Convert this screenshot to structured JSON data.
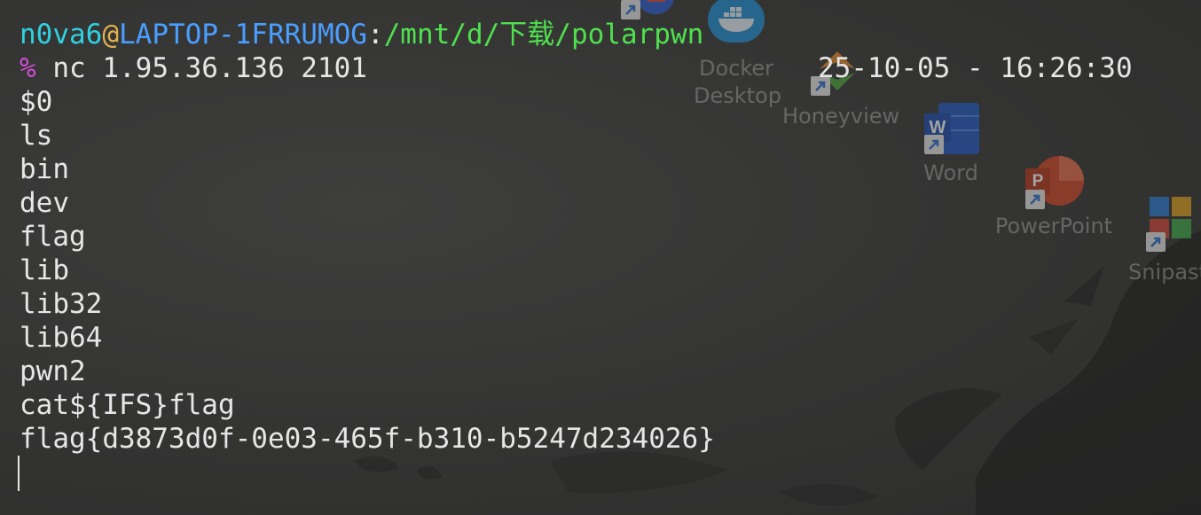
{
  "desktop": {
    "icons": [
      {
        "name": "Docker Desktop",
        "label_line1": "Docker",
        "label_line2": "Desktop",
        "icon": "docker-whale-icon"
      },
      {
        "name": "Honeyview",
        "label": "Honeyview",
        "icon": "honeyview-icon"
      },
      {
        "name": "Word",
        "label": "Word",
        "icon": "word-icon"
      },
      {
        "name": "PowerPoint",
        "label": "PowerPoint",
        "icon": "powerpoint-icon"
      },
      {
        "name": "Snipaste",
        "label": "Snipast",
        "icon": "snipaste-icon"
      }
    ],
    "colors": {
      "docker": "#1d8fd6",
      "word": "#1f58c4",
      "powerpoint": "#d04423",
      "honeyview_orange": "#e98a2b",
      "honeyview_green": "#4aa63a"
    }
  },
  "terminal": {
    "prompt": {
      "user": "n0va6",
      "at": "@",
      "host": "LAPTOP-1FRRUMOG",
      "colon": ":",
      "path": "/mnt/d/下载/polarpwn"
    },
    "command_line": {
      "symbol": "%",
      "command": " nc 1.95.36.136 2101"
    },
    "timestamp": "25-10-05 - 16:26:30",
    "output_lines": [
      "$0",
      "ls",
      "bin",
      "dev",
      "flag",
      "lib",
      "lib32",
      "lib64",
      "pwn2",
      "cat${IFS}flag",
      "flag{d3873d0f-0e03-465f-b310-b5247d234026}"
    ],
    "colors": {
      "user": "#2fd1e0",
      "at": "#e0b24e",
      "host": "#4a9eff",
      "path": "#4fe04f",
      "percent": "#d24fd6",
      "text": "#e6e6e6"
    }
  }
}
